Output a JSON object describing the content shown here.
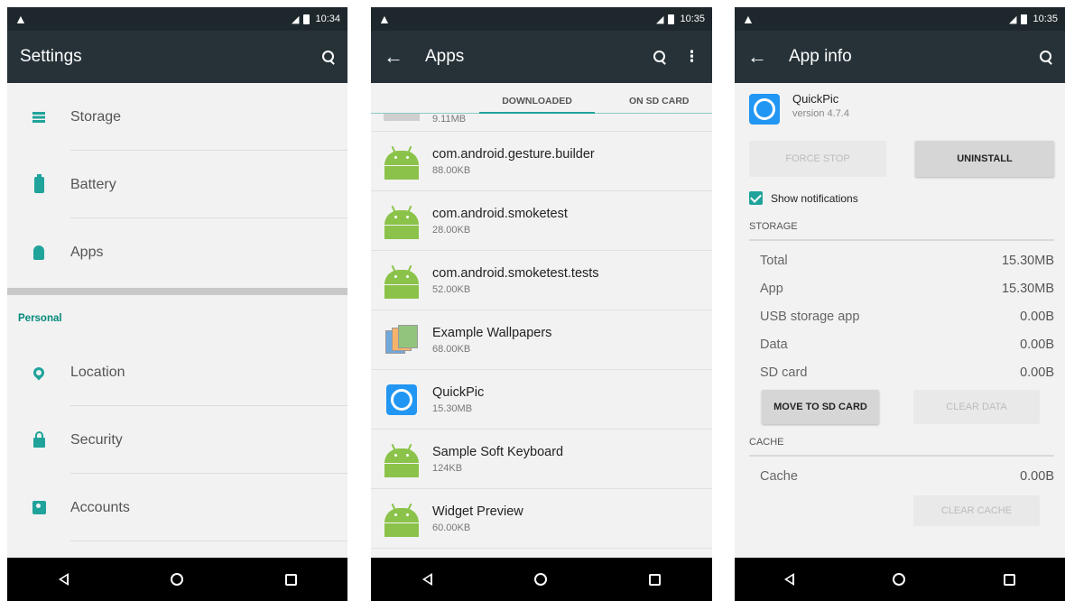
{
  "status": {
    "time1": "10:34",
    "time2": "10:35",
    "time3": "10:35"
  },
  "settings": {
    "title": "Settings",
    "items": [
      {
        "label": "Storage"
      },
      {
        "label": "Battery"
      },
      {
        "label": "Apps"
      }
    ],
    "group_label": "Personal",
    "personal_items": [
      {
        "label": "Location"
      },
      {
        "label": "Security"
      },
      {
        "label": "Accounts"
      }
    ]
  },
  "apps": {
    "title": "Apps",
    "tabs": [
      "DOWNLOADED",
      "ON SD CARD"
    ],
    "partial_size": "9.11MB",
    "list": [
      {
        "name": "com.android.gesture.builder",
        "size": "88.00KB",
        "icon": "android-icon"
      },
      {
        "name": "com.android.smoketest",
        "size": "28.00KB",
        "icon": "android-icon"
      },
      {
        "name": "com.android.smoketest.tests",
        "size": "52.00KB",
        "icon": "android-icon"
      },
      {
        "name": "Example Wallpapers",
        "size": "68.00KB",
        "icon": "wallpapers-icon"
      },
      {
        "name": "QuickPic",
        "size": "15.30MB",
        "icon": "quickpic-icon"
      },
      {
        "name": "Sample Soft Keyboard",
        "size": "124KB",
        "icon": "android-icon"
      },
      {
        "name": "Widget Preview",
        "size": "60.00KB",
        "icon": "android-icon"
      }
    ]
  },
  "appinfo": {
    "title": "App info",
    "app_name": "QuickPic",
    "version": "version 4.7.4",
    "force_stop": "FORCE STOP",
    "uninstall": "UNINSTALL",
    "show_notifications": "Show notifications",
    "storage_label": "STORAGE",
    "storage": [
      {
        "k": "Total",
        "v": "15.30MB"
      },
      {
        "k": "App",
        "v": "15.30MB"
      },
      {
        "k": "USB storage app",
        "v": "0.00B"
      },
      {
        "k": "Data",
        "v": "0.00B"
      },
      {
        "k": "SD card",
        "v": "0.00B"
      }
    ],
    "move_to_sd": "MOVE TO SD CARD",
    "clear_data": "CLEAR DATA",
    "cache_label": "CACHE",
    "cache": {
      "k": "Cache",
      "v": "0.00B"
    },
    "clear_cache": "CLEAR CACHE"
  },
  "colors": {
    "accent": "#20a39a",
    "toolbar": "#263238",
    "statusbar": "#1e272c"
  }
}
